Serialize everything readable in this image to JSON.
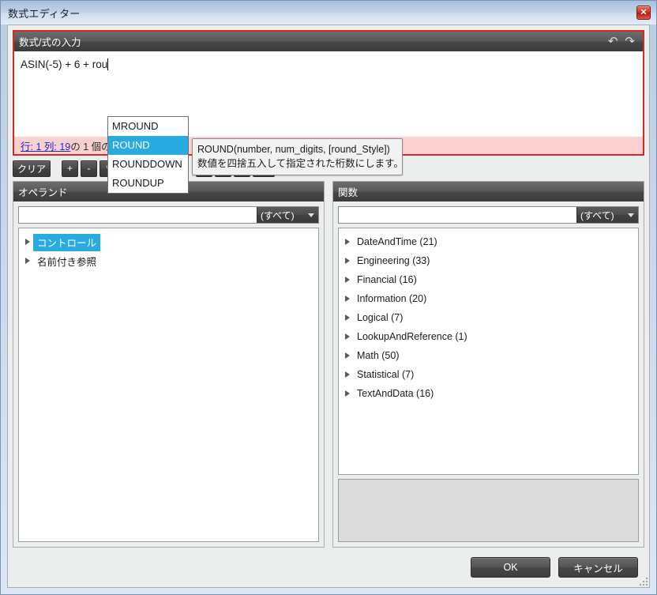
{
  "window": {
    "title": "数式エディター",
    "close_icon": "close-x-icon"
  },
  "formula_panel": {
    "header": "数式/式の入力",
    "undo_icon": "↶",
    "redo_icon": "↷",
    "formula_value": "ASIN(-5) + 6 + rou",
    "error_link": "行: 1  列: 19",
    "error_message": " の 1 個の ",
    "error_border_color": "#d42b1e",
    "error_bg_color": "#fad0d0"
  },
  "autocomplete": {
    "items": [
      {
        "label": "MROUND",
        "selected": false
      },
      {
        "label": "ROUND",
        "selected": true
      },
      {
        "label": "ROUNDDOWN",
        "selected": false
      },
      {
        "label": "ROUNDUP",
        "selected": false
      }
    ],
    "highlight_color": "#29abe2"
  },
  "tooltip": {
    "signature": "ROUND(number, num_digits, [round_Style])",
    "description": "数値を四捨五入して指定された桁数にします。"
  },
  "operators": {
    "clear_label": "クリア",
    "group1": [
      "+",
      "-",
      "*",
      "/"
    ],
    "group2": [
      "^",
      "%"
    ],
    "group3": [
      ">",
      "<",
      "=",
      "<>"
    ]
  },
  "operand_panel": {
    "header": "オペランド",
    "filter_value": "",
    "filter_placeholder": "",
    "combo_label": "(すべて)",
    "tree": [
      {
        "label": "コントロール",
        "selected": true
      },
      {
        "label": "名前付き参照",
        "selected": false
      }
    ]
  },
  "function_panel": {
    "header": "関数",
    "filter_value": "",
    "filter_placeholder": "",
    "combo_label": "(すべて)",
    "tree": [
      {
        "label": "DateAndTime (21)",
        "selected": false
      },
      {
        "label": "Engineering (33)",
        "selected": false
      },
      {
        "label": "Financial (16)",
        "selected": false
      },
      {
        "label": "Information (20)",
        "selected": false
      },
      {
        "label": "Logical (7)",
        "selected": false
      },
      {
        "label": "LookupAndReference (1)",
        "selected": false
      },
      {
        "label": "Math (50)",
        "selected": false
      },
      {
        "label": "Statistical (7)",
        "selected": false
      },
      {
        "label": "TextAndData (16)",
        "selected": false
      }
    ],
    "description_text": ""
  },
  "footer": {
    "ok_label": "OK",
    "cancel_label": "キャンセル"
  }
}
